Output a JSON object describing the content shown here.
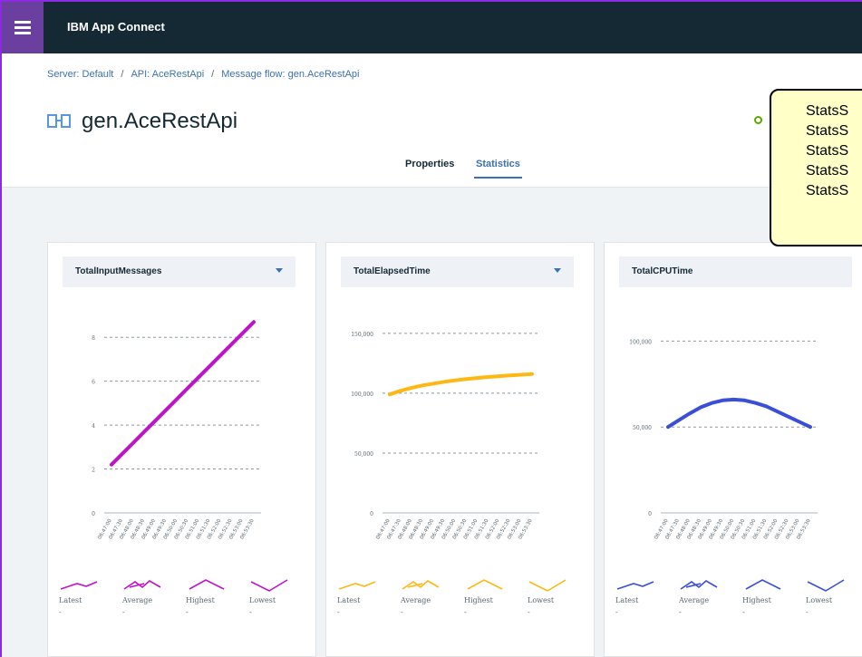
{
  "app": {
    "title": "IBM App Connect",
    "menu_icon": "hamburger-menu-icon"
  },
  "breadcrumb": [
    "Server: Default",
    "API: AceRestApi",
    "Message flow: gen.AceRestApi"
  ],
  "page": {
    "title": "gen.AceRestApi",
    "icon": "message-flow-icon",
    "status_color": "#5aa700"
  },
  "tabs": [
    {
      "label": "Properties",
      "active": false
    },
    {
      "label": "Statistics",
      "active": true
    }
  ],
  "callout": {
    "lines": [
      "StatsS",
      "StatsS",
      "StatsS",
      "StatsS",
      "StatsS"
    ]
  },
  "x_ticks": [
    "06:47:00",
    "06:47:30",
    "06:48:00",
    "06:48:30",
    "06:49:00",
    "06:49:30",
    "06:50:00",
    "06:50:30",
    "06:51:00",
    "06:51:30",
    "06:52:00",
    "06:52:30",
    "06:53:00",
    "06:53:30"
  ],
  "cards": [
    {
      "metric": "TotalInputMessages",
      "has_dropdown": true,
      "color": "#c013c9",
      "y_ticks": [
        "8",
        "6",
        "4",
        "2",
        "0"
      ],
      "chart_data": {
        "type": "line",
        "series": [
          {
            "values": [
              2.2,
              2.7,
              3.2,
              3.7,
              4.2,
              4.7,
              5.2,
              5.7,
              6.2,
              6.7,
              7.2,
              7.7,
              8.2,
              8.7
            ]
          }
        ],
        "ylim": [
          0,
          9
        ]
      },
      "legend": [
        {
          "label": "Latest",
          "value": "-"
        },
        {
          "label": "Average",
          "value": "-"
        },
        {
          "label": "Highest",
          "value": "-"
        },
        {
          "label": "Lowest",
          "value": "-"
        }
      ]
    },
    {
      "metric": "TotalElapsedTime",
      "has_dropdown": true,
      "color": "#fdb813",
      "y_ticks": [
        "150,000",
        "100,000",
        "50,000",
        "0"
      ],
      "chart_data": {
        "type": "line",
        "series": [
          {
            "values": [
              99000,
              102000,
              104500,
              106500,
              108000,
              109500,
              110800,
              111800,
              112700,
              113500,
              114200,
              114800,
              115400,
              116000
            ]
          }
        ],
        "ylim": [
          0,
          165000
        ]
      },
      "legend": [
        {
          "label": "Latest",
          "value": "-"
        },
        {
          "label": "Average",
          "value": "-"
        },
        {
          "label": "Highest",
          "value": "-"
        },
        {
          "label": "Lowest",
          "value": "-"
        }
      ]
    },
    {
      "metric": "TotalCPUTime",
      "has_dropdown": false,
      "color": "#3b4ed8",
      "y_ticks": [
        "100,000",
        "50,000",
        "0"
      ],
      "chart_data": {
        "type": "line",
        "series": [
          {
            "values": [
              50000,
              54000,
              58000,
              61500,
              64000,
              65500,
              66000,
              65500,
              64000,
              62000,
              59000,
              56000,
              53000,
              50000
            ]
          }
        ],
        "ylim": [
          0,
          115000
        ]
      },
      "legend": [
        {
          "label": "Latest",
          "value": "-"
        },
        {
          "label": "Average",
          "value": "-"
        },
        {
          "label": "Highest",
          "value": "-"
        },
        {
          "label": "Lowest",
          "value": "-"
        }
      ]
    }
  ]
}
